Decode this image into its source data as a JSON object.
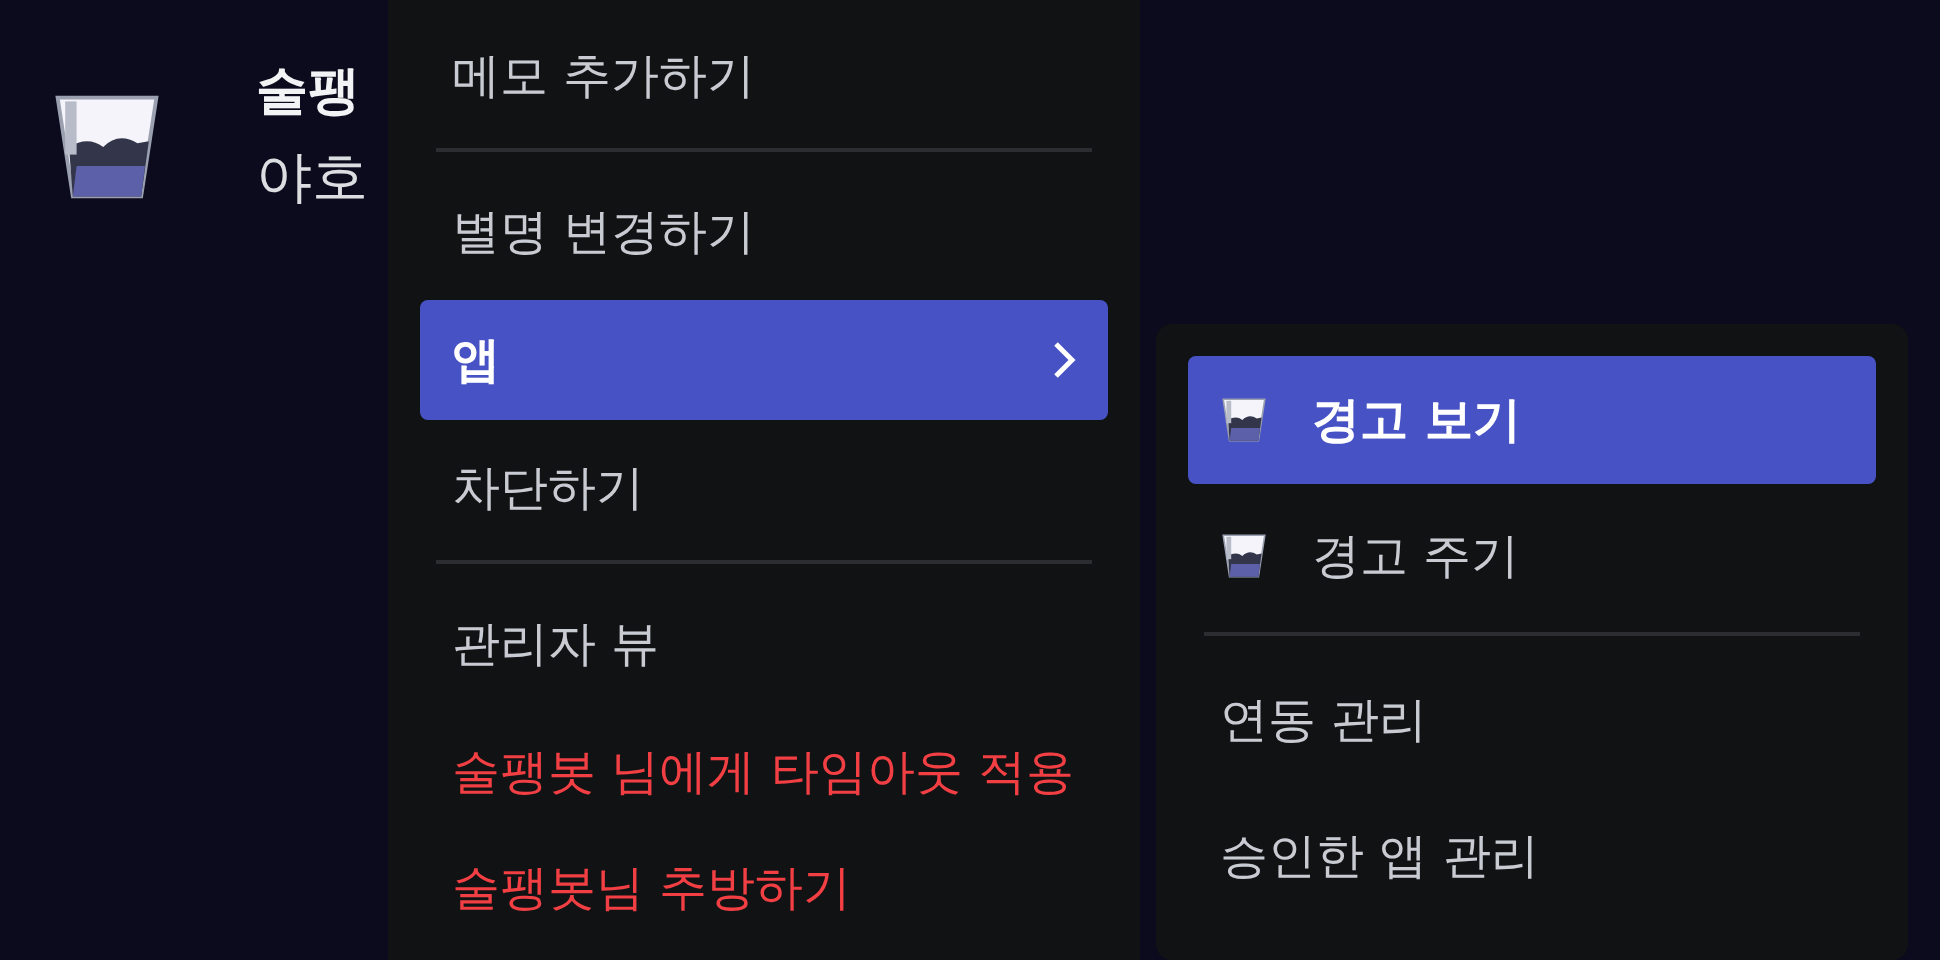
{
  "profile": {
    "name": "술팽",
    "subtitle": "야호"
  },
  "menu": {
    "items": [
      {
        "kind": "item",
        "label": "메모 추가하기",
        "selected": false,
        "danger": false,
        "has_submenu": false
      },
      {
        "kind": "separator"
      },
      {
        "kind": "item",
        "label": "별명 변경하기",
        "selected": false,
        "danger": false,
        "has_submenu": false
      },
      {
        "kind": "item",
        "label": "앱",
        "selected": true,
        "danger": false,
        "has_submenu": true
      },
      {
        "kind": "item",
        "label": "차단하기",
        "selected": false,
        "danger": false,
        "has_submenu": false
      },
      {
        "kind": "separator"
      },
      {
        "kind": "item",
        "label": "관리자 뷰",
        "selected": false,
        "danger": false,
        "has_submenu": false
      },
      {
        "kind": "item",
        "label": "술팽봇 님에게 타임아웃 적용",
        "selected": false,
        "danger": true,
        "has_submenu": false
      },
      {
        "kind": "item",
        "label": "술팽봇님 추방하기",
        "selected": false,
        "danger": true,
        "has_submenu": false
      }
    ]
  },
  "submenu": {
    "items": [
      {
        "kind": "app",
        "label": "경고 보기",
        "selected": true,
        "danger": false,
        "has_submenu": false
      },
      {
        "kind": "app",
        "label": "경고 주기",
        "selected": false,
        "danger": false,
        "has_submenu": false
      },
      {
        "kind": "separator"
      },
      {
        "kind": "item",
        "label": "연동 관리",
        "selected": false,
        "danger": false,
        "has_submenu": false
      },
      {
        "kind": "item",
        "label": "승인한 앱 관리",
        "selected": false,
        "danger": false,
        "has_submenu": false
      }
    ]
  }
}
